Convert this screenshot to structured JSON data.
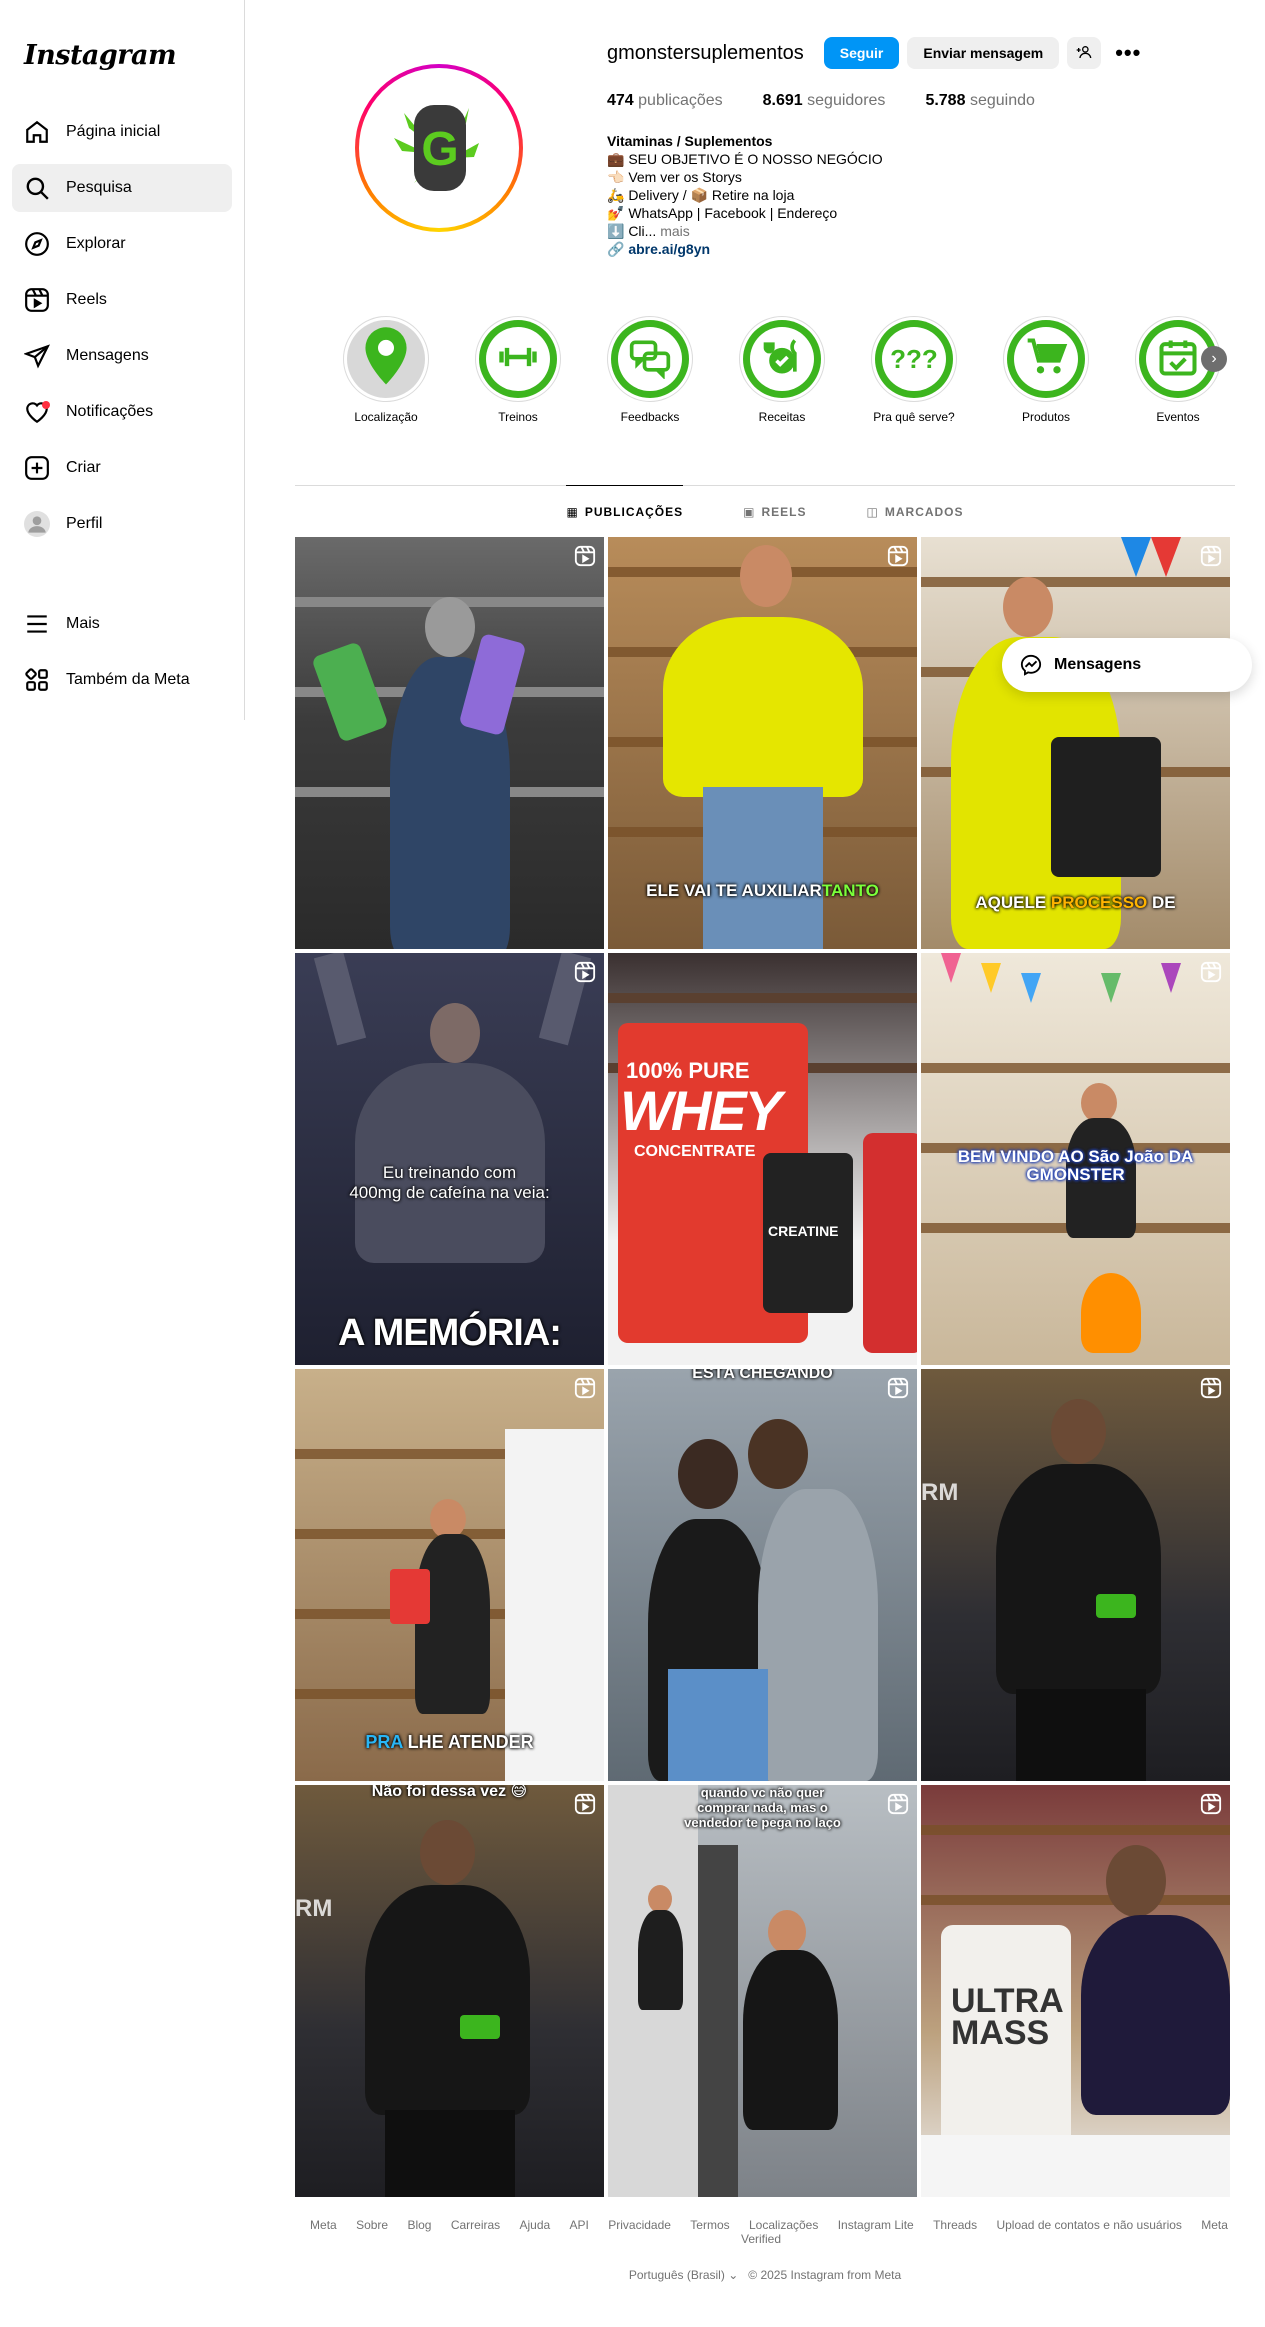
{
  "app": {
    "logo": "Instagram"
  },
  "sidebar": {
    "items": [
      {
        "label": "Página inicial",
        "icon": "home-icon"
      },
      {
        "label": "Pesquisa",
        "icon": "search-icon",
        "active": true
      },
      {
        "label": "Explorar",
        "icon": "compass-icon"
      },
      {
        "label": "Reels",
        "icon": "reels-icon"
      },
      {
        "label": "Mensagens",
        "icon": "messenger-icon"
      },
      {
        "label": "Notificações",
        "icon": "heart-icon"
      },
      {
        "label": "Criar",
        "icon": "plus-square-icon"
      },
      {
        "label": "Perfil",
        "icon": "avatar"
      }
    ],
    "bottom": [
      {
        "label": "Mais",
        "icon": "menu-icon"
      },
      {
        "label": "Também da Meta",
        "icon": "meta-grid-icon"
      }
    ]
  },
  "profile": {
    "username": "gmonstersuplementos",
    "follow_label": "Seguir",
    "message_label": "Enviar mensagem",
    "stats": {
      "posts_count": "474",
      "posts_label": "publicações",
      "followers_count": "8.691",
      "followers_label": "seguidores",
      "following_count": "5.788",
      "following_label": "seguindo"
    },
    "bio": {
      "name": "Vitaminas / Suplementos",
      "lines": [
        "💼 SEU OBJETIVO É O NOSSO NEGÓCIO",
        "👈🏻 Vem ver os Storys",
        "🛵 Delivery / 📦 Retire na loja",
        "💅 WhatsApp | Facebook | Endereço",
        "⬇️ Cli..."
      ],
      "more": " mais",
      "link": "abre.ai/g8yn"
    }
  },
  "highlights": [
    {
      "label": "Localização",
      "icon": "map-pin-icon"
    },
    {
      "label": "Treinos",
      "icon": "dumbbell-icon"
    },
    {
      "label": "Feedbacks",
      "icon": "chat-bubbles-icon"
    },
    {
      "label": "Receitas",
      "icon": "recipe-icon"
    },
    {
      "label": "Pra quê serve?",
      "icon": "question-marks-icon"
    },
    {
      "label": "Produtos",
      "icon": "cart-icon"
    },
    {
      "label": "Eventos",
      "icon": "calendar-check-icon"
    }
  ],
  "tabs": [
    {
      "label": "PUBLICAÇÕES",
      "icon": "grid-icon",
      "active": true
    },
    {
      "label": "REELS",
      "icon": "reels-icon"
    },
    {
      "label": "MARCADOS",
      "icon": "tag-icon"
    }
  ],
  "posts": [
    {
      "caption": "",
      "reel": true
    },
    {
      "caption_a": "ELE VAI TE AUXILIAR",
      "caption_b": "TANTO",
      "reel": true
    },
    {
      "caption_a": "AQUELE",
      "caption_b": "PROCESSO",
      "caption_c": "DE",
      "reel": true
    },
    {
      "caption_a": "Eu treinando com",
      "caption_b": "400mg de cafeína na veia:",
      "caption_c": "A MEMÓRIA:",
      "reel": true
    },
    {
      "caption_a": "100% PURE",
      "caption_b": "WHEY",
      "caption_c": "CONCENTRATE",
      "caption_d": "CREATINE",
      "reel": false
    },
    {
      "caption": "BEM VINDO AO São João DA GMONSTER",
      "reel": true
    },
    {
      "caption_a": "PRA",
      "caption_b": "LHE ATENDER",
      "reel": true
    },
    {
      "caption": "ESTÁ CHEGANDO",
      "reel": true
    },
    {
      "caption": "",
      "reel": true
    },
    {
      "caption": "Não foi dessa vez 😅",
      "reel": true
    },
    {
      "caption": "quando vc não quer comprar nada, mas o vendedor te pega no laço",
      "reel": true
    },
    {
      "caption_a": "ULTRA",
      "caption_b": "MASS",
      "reel": true
    }
  ],
  "messages_bubble": {
    "label": "Mensagens"
  },
  "footer": {
    "links": [
      "Meta",
      "Sobre",
      "Blog",
      "Carreiras",
      "Ajuda",
      "API",
      "Privacidade",
      "Termos",
      "Localizações",
      "Instagram Lite",
      "Threads",
      "Upload de contatos e não usuários",
      "Meta Verified"
    ],
    "language": "Português (Brasil)",
    "copyright": "© 2025 Instagram from Meta"
  },
  "colors": {
    "primary": "#0095f6",
    "highlight_green": "#3cb51e",
    "notification": "#ff3040"
  }
}
